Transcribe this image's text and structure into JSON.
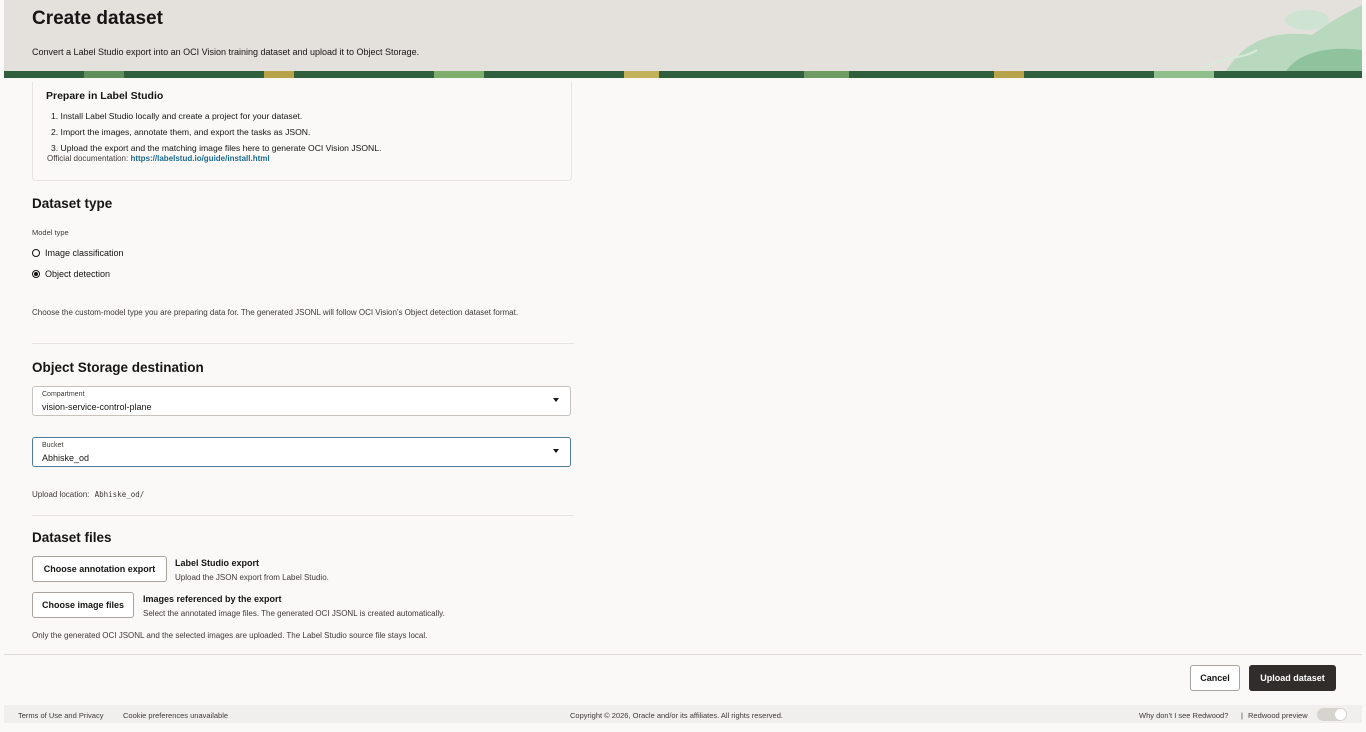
{
  "header": {
    "title": "Create dataset",
    "subtitle": "Convert a Label Studio export into an OCI Vision training dataset and upload it to Object Storage."
  },
  "prepare": {
    "title": "Prepare in Label Studio",
    "steps": [
      "1. Install Label Studio locally and create a project for your dataset.",
      "2. Import the images, annotate them, and export the tasks as JSON.",
      "3. Upload the export and the matching image files here to generate OCI Vision JSONL."
    ],
    "doc_label": "Official documentation:",
    "doc_link": "https://labelstud.io/guide/install.html"
  },
  "dataset_type": {
    "title": "Dataset type",
    "model_type_label": "Model type",
    "options": [
      "Image classification",
      "Object detection"
    ],
    "selected": "Object detection",
    "help": "Choose the custom-model type you are preparing data for. The generated JSONL will follow OCI Vision's Object detection dataset format."
  },
  "storage": {
    "title": "Object Storage destination",
    "compartment": {
      "label": "Compartment",
      "value": "vision-service-control-plane"
    },
    "bucket": {
      "label": "Bucket",
      "value": "Abhiske_od"
    },
    "upload_location_label": "Upload location:",
    "upload_location_value": "Abhiske_od/"
  },
  "files": {
    "title": "Dataset files",
    "annotation": {
      "button": "Choose annotation export",
      "title": "Label Studio export",
      "desc": "Upload the JSON export from Label Studio."
    },
    "images": {
      "button": "Choose image files",
      "title": "Images referenced by the export",
      "desc": "Select the annotated image files. The generated OCI JSONL is created automatically."
    },
    "note": "Only the generated OCI JSONL and the selected images are uploaded. The Label Studio source file stays local."
  },
  "actions": {
    "cancel": "Cancel",
    "upload": "Upload dataset"
  },
  "footer": {
    "terms": "Terms of Use and Privacy",
    "cookies": "Cookie preferences unavailable",
    "copyright": "Copyright © 2026, Oracle and/or its affiliates. All rights reserved.",
    "redwood_q": "Why don't I see Redwood?",
    "separator": "|",
    "redwood_preview": "Redwood preview"
  },
  "colors": {
    "header_bg": "#e4e1dd",
    "primary_button": "#312d2a",
    "link": "#1c6a8d",
    "focus_border": "#4f7d9b"
  }
}
